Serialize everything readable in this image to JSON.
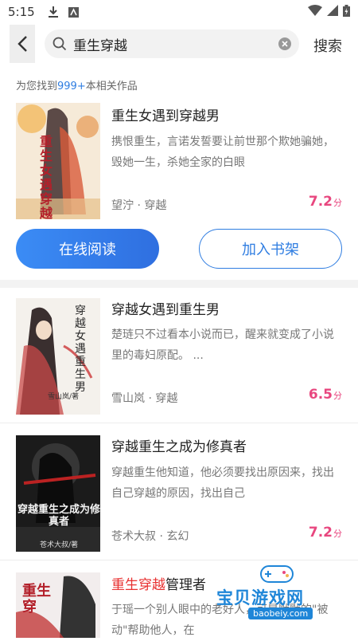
{
  "status_bar": {
    "time": "5:15"
  },
  "header": {
    "query": "重生穿越",
    "search_label": "搜索"
  },
  "result": {
    "prefix": "为您找到",
    "count": "999+",
    "suffix": "本相关作品"
  },
  "buttons": {
    "read": "在线阅读",
    "shelf": "加入书架"
  },
  "books": [
    {
      "title": "重生女遇到穿越男",
      "desc": "携恨重生，言诺发誓要让前世那个欺她骗她，毁她一生，杀她全家的白眼",
      "author_genre": "望泞 · 穿越",
      "score": "7.2",
      "score_unit": "分"
    },
    {
      "title": "穿越女遇到重生男",
      "desc": "楚琏只不过看本小说而已，醒来就变成了小说里的毒妇原配。 ...",
      "author_genre": "雪山岚 · 穿越",
      "score": "6.5",
      "score_unit": "分"
    },
    {
      "title": "穿越重生之成为修真者",
      "desc": "穿越重生他知道，他必须要找出原因来，找出自己穿越的原因，找出自己",
      "author_genre": "苍术大叔 · 玄幻",
      "score": "7.2",
      "score_unit": "分"
    },
    {
      "title_highlight": "重生穿越",
      "title_rest": "管理者",
      "desc": "于瑶一个别人眼中的老好人，可是默默的\"被动\"帮助他人，在"
    }
  ],
  "covers": [
    {
      "text": "重生女遇穿越男"
    },
    {
      "text": "穿越女遇重生男",
      "author": "雪山岚/著"
    },
    {
      "text": "穿越重生之成为修真者",
      "author": "苍术大叔/著"
    },
    {
      "text": "重生穿"
    }
  ],
  "watermark": {
    "name": "宝贝游戏网",
    "url": "baobeiy.com"
  },
  "colors": {
    "accent": "#2f7de1",
    "score": "#e8477f",
    "highlight": "#e83030"
  }
}
